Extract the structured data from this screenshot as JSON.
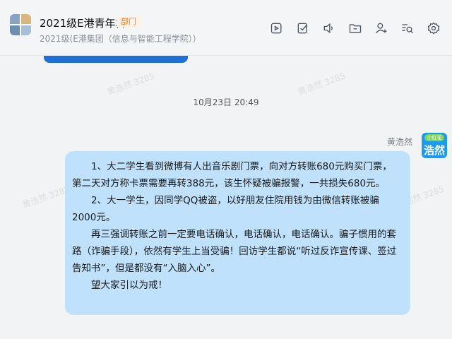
{
  "header": {
    "title": "2021级E港青年群",
    "badge": "部门",
    "subtitle": "2021级(E港集团（信息与智能工程学院））",
    "toolbar": [
      {
        "name": "video-call-icon"
      },
      {
        "name": "check-task-icon"
      },
      {
        "name": "voice-icon"
      },
      {
        "name": "folder-icon"
      },
      {
        "name": "add-member-icon"
      },
      {
        "name": "search-history-icon"
      },
      {
        "name": "settings-icon"
      }
    ]
  },
  "timestamp": "10月23日 20:49",
  "message": {
    "sender": "黄浩然",
    "avatar_tag": "小红花",
    "avatar_text": "浩然",
    "paragraphs": [
      "1、大二学生看到微博有人出音乐剧门票，向对方转账680元购买门票，第二天对方称卡票需要再转388元，该生怀疑被骗报警，一共损失680元。",
      "2、大一学生，因同学QQ被盗，以好朋友住院用钱为由微信转账被骗2000元。",
      "再三强调转账之前一定要电话确认，电话确认，电话确认。骗子惯用的套路（诈骗手段），依然有学生上当受骗！回访学生都说“听过反诈宣传课、签过告知书”，但是都没有“入脑入心”。",
      "望大家引以为戒！"
    ]
  },
  "watermark": "黄浩然 3285"
}
